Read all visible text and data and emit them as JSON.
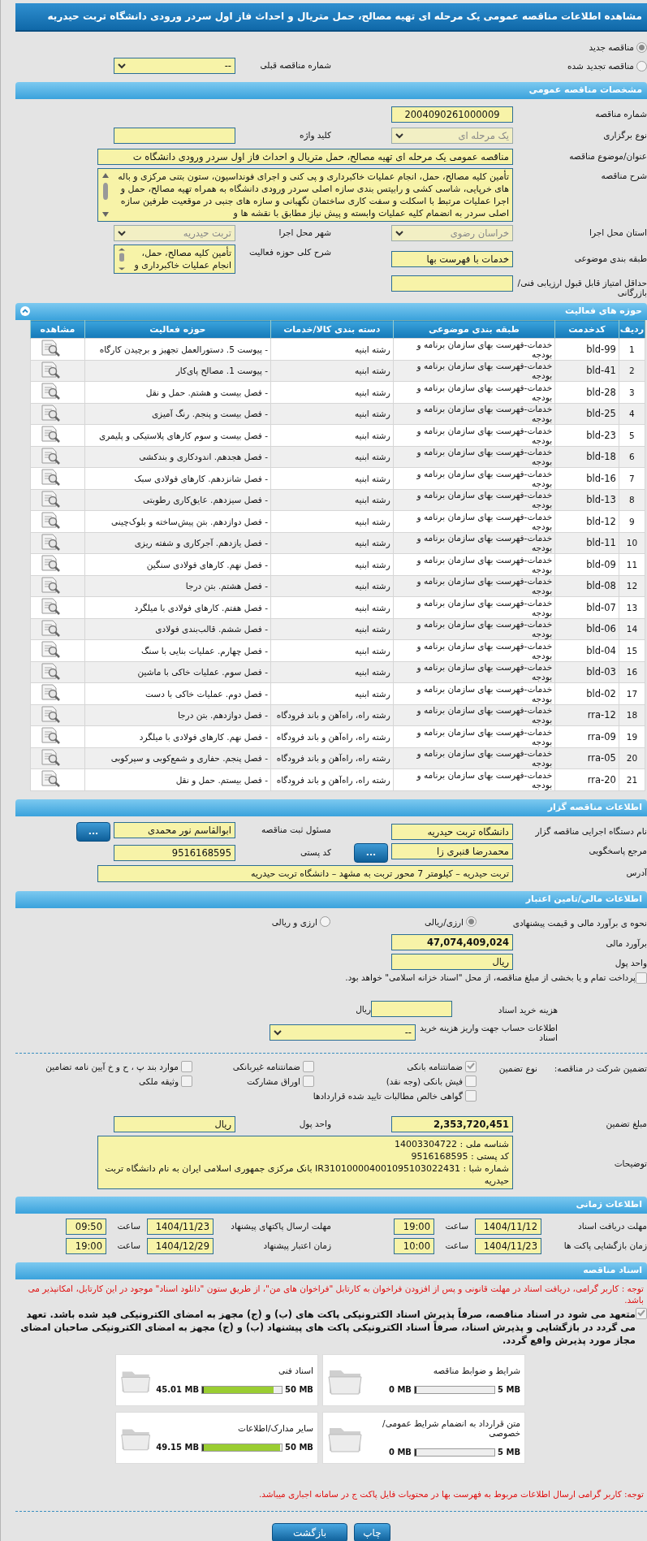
{
  "title": "مشاهده اطلاعات مناقصه عمومی یک مرحله ای تهیه مصالح، حمل متریال و احداث فاز اول سردر ورودی دانشگاه تربت حیدریه",
  "tender_type": [
    {
      "label": "مناقصه جدید",
      "selected": true
    },
    {
      "label": "مناقصه تجدید شده",
      "selected": false
    }
  ],
  "previous_number": {
    "label": "شماره مناقصه قبلی",
    "value": "--"
  },
  "general": {
    "heading": "مشخصات مناقصه عمومی",
    "rows": [
      {
        "fields": [
          {
            "label": "شماره مناقصه",
            "kind": "text",
            "value": "2004090261000009",
            "center": true
          }
        ]
      },
      {
        "fields": [
          {
            "label": "نوع برگزاری",
            "kind": "select",
            "value": "یک مرحله ای",
            "disabled": true
          },
          {
            "label": "کلید واژه",
            "kind": "text"
          }
        ]
      },
      {
        "fields": [
          {
            "label": "عنوان/موضوع مناقصه",
            "kind": "long-text",
            "value": "مناقصه عمومی یک مرحله ای تهیه مصالح، حمل متریال و احداث فاز اول سردر ورودی دانشگاه ت"
          }
        ]
      },
      {
        "fields": [
          {
            "label": "شرح مناقصه",
            "kind": "memo",
            "scrollable": true,
            "value": "تأمین کلیه مصالح، حمل، انجام عملیات خاکبرداری و پی کنی و اجرای فونداسیون، ستون بتنی مرکزی و باله های خرپایی، شاسی کشی و رابیتس بندی سازه اصلی سردر ورودی دانشگاه به همراه تهیه مصالح، حمل و اجرا عملیات مرتبط با اسکلت و سفت کاری ساختمان نگهبانی و سازه های جنبی در موقعیت طرفین سازه اصلی سردر به انضمام کلیه عملیات وابسته و پیش نیاز مطابق با نقشه ها و"
          }
        ]
      },
      {
        "fields": [
          {
            "label": "استان محل اجرا",
            "kind": "select",
            "value": "خراسان رضوی",
            "disabled": true
          },
          {
            "label": "شهر محل اجرا",
            "kind": "select",
            "value": "تربت حیدریه",
            "disabled": true
          }
        ]
      },
      {
        "fields": [
          {
            "label": "طبقه بندی موضوعی",
            "kind": "text",
            "value": "خدمات با فهرست بها"
          },
          {
            "label": "شرح کلی حوزه فعالیت",
            "kind": "memo",
            "scrollable": true,
            "value": "تأمین کلیه مصالح، حمل، انجام عملیات خاکبرداری و"
          }
        ]
      },
      {
        "fields": [
          {
            "label": "حداقل امتیاز قابل قبول ارزیابی فنی/بازرگانی",
            "kind": "text"
          }
        ]
      }
    ]
  },
  "activities": {
    "heading": "حوزه های فعالیت",
    "expanded": true,
    "columns": [
      "ردیف",
      "کدخدمت",
      "طبقه بندی موضوعی",
      "دسته بندی کالا/خدمات",
      "حوزه فعالیت",
      "مشاهده"
    ],
    "rows": [
      {
        "no": "1",
        "code": "bld-99",
        "category": "خدمات-فهرست بهای سازمان برنامه و بودجه",
        "group": "رشته ابنیه",
        "activity": "- پیوست 5. دستورالعمل تجهیز و برچیدن کارگاه"
      },
      {
        "no": "2",
        "code": "bld-41",
        "category": "خدمات-فهرست بهای سازمان برنامه و بودجه",
        "group": "رشته ابنیه",
        "activity": "- پیوست 1. مصالح پای‌کار"
      },
      {
        "no": "3",
        "code": "bld-28",
        "category": "خدمات-فهرست بهای سازمان برنامه و بودجه",
        "group": "رشته ابنیه",
        "activity": "- فصل بیست و هشتم. حمل و نقل"
      },
      {
        "no": "4",
        "code": "bld-25",
        "category": "خدمات-فهرست بهای سازمان برنامه و بودجه",
        "group": "رشته ابنیه",
        "activity": "- فصل بیست و پنجم. رنگ آمیزی"
      },
      {
        "no": "5",
        "code": "bld-23",
        "category": "خدمات-فهرست بهای سازمان برنامه و بودجه",
        "group": "رشته ابنیه",
        "activity": "- فصل بیست و سوم کارهای پلاستیکی و پلیمری"
      },
      {
        "no": "6",
        "code": "bld-18",
        "category": "خدمات-فهرست بهای سازمان برنامه و بودجه",
        "group": "رشته ابنیه",
        "activity": "- فصل هجدهم. اندودکاری و بندکشی"
      },
      {
        "no": "7",
        "code": "bld-16",
        "category": "خدمات-فهرست بهای سازمان برنامه و بودجه",
        "group": "رشته ابنیه",
        "activity": "- فصل شانزدهم. کارهای فولادی سبک"
      },
      {
        "no": "8",
        "code": "bld-13",
        "category": "خدمات-فهرست بهای سازمان برنامه و بودجه",
        "group": "رشته ابنیه",
        "activity": "- فصل سیزدهم. عایق‌کاری رطوبتی"
      },
      {
        "no": "9",
        "code": "bld-12",
        "category": "خدمات-فهرست بهای سازمان برنامه و بودجه",
        "group": "رشته ابنیه",
        "activity": "- فصل دوازدهم. بتن پیش‌ساخته و بلوک‌چینی"
      },
      {
        "no": "10",
        "code": "bld-11",
        "category": "خدمات-فهرست بهای سازمان برنامه و بودجه",
        "group": "رشته ابنیه",
        "activity": "- فصل یازدهم. آجرکاری و شفته ریزی"
      },
      {
        "no": "11",
        "code": "bld-09",
        "category": "خدمات-فهرست بهای سازمان برنامه و بودجه",
        "group": "رشته ابنیه",
        "activity": "- فصل نهم. کارهای فولادی سنگین"
      },
      {
        "no": "12",
        "code": "bld-08",
        "category": "خدمات-فهرست بهای سازمان برنامه و بودجه",
        "group": "رشته ابنیه",
        "activity": "- فصل هشتم. بتن درجا"
      },
      {
        "no": "13",
        "code": "bld-07",
        "category": "خدمات-فهرست بهای سازمان برنامه و بودجه",
        "group": "رشته ابنیه",
        "activity": "- فصل هفتم. کارهای فولادی با میلگرد"
      },
      {
        "no": "14",
        "code": "bld-06",
        "category": "خدمات-فهرست بهای سازمان برنامه و بودجه",
        "group": "رشته ابنیه",
        "activity": "- فصل ششم. قالب‌بندی فولادی"
      },
      {
        "no": "15",
        "code": "bld-04",
        "category": "خدمات-فهرست بهای سازمان برنامه و بودجه",
        "group": "رشته ابنیه",
        "activity": "- فصل چهارم. عملیات بنایی با سنگ"
      },
      {
        "no": "16",
        "code": "bld-03",
        "category": "خدمات-فهرست بهای سازمان برنامه و بودجه",
        "group": "رشته ابنیه",
        "activity": "- فصل سوم. عملیات خاکی با ماشین"
      },
      {
        "no": "17",
        "code": "bld-02",
        "category": "خدمات-فهرست بهای سازمان برنامه و بودجه",
        "group": "رشته ابنیه",
        "activity": "- فصل دوم. عملیات خاکی با دست"
      },
      {
        "no": "18",
        "code": "rra-12",
        "category": "خدمات-فهرست بهای سازمان برنامه و بودجه",
        "group": "رشته راه، راه‌آهن و باند فرودگاه",
        "activity": "- فصل دوازدهم. بتن درجا"
      },
      {
        "no": "19",
        "code": "rra-09",
        "category": "خدمات-فهرست بهای سازمان برنامه و بودجه",
        "group": "رشته راه، راه‌آهن و باند فرودگاه",
        "activity": "- فصل نهم. کارهای فولادی با میلگرد"
      },
      {
        "no": "20",
        "code": "rra-05",
        "category": "خدمات-فهرست بهای سازمان برنامه و بودجه",
        "group": "رشته راه، راه‌آهن و باند فرودگاه",
        "activity": "- فصل پنجم. حفاری و شمع‌کوبی و سپرکوبی"
      },
      {
        "no": "21",
        "code": "rra-20",
        "category": "خدمات-فهرست بهای سازمان برنامه و بودجه",
        "group": "رشته راه، راه‌آهن و باند فرودگاه",
        "activity": "- فصل بیستم. حمل و نقل"
      }
    ]
  },
  "organizer": {
    "heading": "اطلاعات مناقصه گزار",
    "rows": [
      {
        "fields": [
          {
            "label": "نام دستگاه اجرایی مناقصه گزار",
            "kind": "text",
            "value": "دانشگاه تربت حیدریه"
          },
          {
            "label": "مسئول ثبت مناقصه",
            "kind": "text",
            "value": "ابوالقاسم نور محمدی",
            "button": "..."
          }
        ]
      },
      {
        "fields": [
          {
            "label": "مرجع پاسخگویی",
            "kind": "text",
            "value": "محمدرضا قنبری زا",
            "button": "..."
          },
          {
            "label": "کد پستی",
            "kind": "text",
            "value": "9516168595",
            "ltr": true
          }
        ]
      },
      {
        "fields": [
          {
            "label": "آدرس",
            "kind": "memo",
            "value": "تربت حیدریه – کیلومتر 7 محور تربت به مشهد – دانشگاه تربت حیدریه"
          }
        ]
      }
    ]
  },
  "financial": {
    "heading": "اطلاعات مالی/تامین اعتبار",
    "estimate_method": {
      "label": "نحوه ی برآورد مالی و قیمت پیشنهادی",
      "options": [
        {
          "label": "ارزی/ریالی",
          "selected": true
        },
        {
          "label": "ارزی و ریالی",
          "selected": false
        }
      ]
    },
    "estimate": {
      "label": "برآورد مالی",
      "value": "47,074,409,024"
    },
    "currency": {
      "label": "واحد پول",
      "value": "ریال"
    },
    "treasury": {
      "label": "پرداخت تمام و یا بخشی از مبلغ مناقصه، از محل \"اسناد خزانه اسلامی\" خواهد بود.",
      "checked": false
    },
    "document_fee": {
      "label": "هزینه خرید اسناد",
      "unit": "ریال"
    },
    "account": {
      "label": "اطلاعات حساب جهت واریز هزینه خرید اسناد",
      "value": "--"
    },
    "guarantee": {
      "label": "تضمین شرکت در مناقصه:",
      "type_label": "نوع تضمین",
      "options": [
        {
          "label": "ضمانتنامه بانکی",
          "checked": true
        },
        {
          "label": "ضمانتنامه غیربانکی",
          "checked": false
        },
        {
          "label": "موارد بند پ ، ح و خ آیین نامه تضامین",
          "checked": false
        },
        {
          "label": "فیش بانکی (وجه نقد)",
          "checked": false
        },
        {
          "label": "اوراق مشارکت",
          "checked": false
        },
        {
          "label": "وثیقه ملکی",
          "checked": false
        },
        {
          "label": "گواهی خالص مطالبات تایید شده قراردادها",
          "checked": false
        }
      ]
    },
    "guarantee_amount": {
      "label": "مبلغ تضمین",
      "value": "2,353,720,451"
    },
    "guarantee_currency": {
      "label": "واحد پول",
      "value": "ریال"
    },
    "notes": {
      "label": "توضیحات",
      "lines": [
        "شناسه ملی : 14003304722",
        "کد پستی : 9516168595",
        "شماره شبا : IR310100004001095103022431 بانک مرکزی جمهوری اسلامی ایران به نام دانشگاه تربت حیدریه"
      ]
    }
  },
  "timing": {
    "heading": "اطلاعات زمانی",
    "rows": [
      [
        {
          "label": "مهلت دریافت اسناد",
          "date": "1404/11/12",
          "time_label": "ساعت",
          "time": "19:00"
        },
        {
          "label": "مهلت ارسال پاکتهای پیشنهاد",
          "date": "1404/11/23",
          "time_label": "ساعت",
          "time": "09:50"
        }
      ],
      [
        {
          "label": "زمان بازگشایی پاکت ها",
          "date": "1404/11/23",
          "time_label": "ساعت",
          "time": "10:00"
        },
        {
          "label": "زمان اعتبار پیشنهاد",
          "date": "1404/12/29",
          "time_label": "ساعت",
          "time": "19:00"
        }
      ]
    ]
  },
  "documents": {
    "heading": "اسناد مناقصه",
    "notice": "توجه : کاربر گرامی، دریافت اسناد در مهلت قانونی و پس از افزودن فراخوان به کارتابل \"فراخوان های من\"، از طریق ستون \"دانلود اسناد\" موجود در این کارتابل، امکانپذیر می باشد.",
    "commitment": {
      "text": "متعهد می شود در اسناد مناقصه، صرفاً پذیرش اسناد الکترونیکی پاکت های (ب) و (ج) مجهز به امضای الکترونیکی قید شده باشد. تعهد می گردد در بازگشایی و پذیرش اسناد، صرفاً اسناد الکترونیکی پاکت های پیشنهاد (ب) و (ج) مجهز به امضای الکترونیکی صاحبان امضای مجاز مورد پذیرش واقع گردد.",
      "checked": true
    },
    "files": [
      {
        "name": "شرایط و ضوابط مناقصه",
        "max": "5 MB",
        "used": "0 MB",
        "level": 0
      },
      {
        "name": "اسناد فنی",
        "max": "50 MB",
        "used": "45.01 MB",
        "level": 0.9
      },
      {
        "name": "متن قرارداد به انضمام شرایط عمومی/خصوصی",
        "max": "5 MB",
        "used": "0 MB",
        "level": 0
      },
      {
        "name": "سایر مدارک/اطلاعات",
        "max": "50 MB",
        "used": "49.15 MB",
        "level": 0.983
      }
    ],
    "notice2": "توجه: کاربر گرامی ارسال اطلاعات مربوط به فهرست بها در محتویات فایل پاکت ج در سامانه اجباری میباشد."
  },
  "buttons": [
    "چاپ",
    "بازگشت"
  ]
}
